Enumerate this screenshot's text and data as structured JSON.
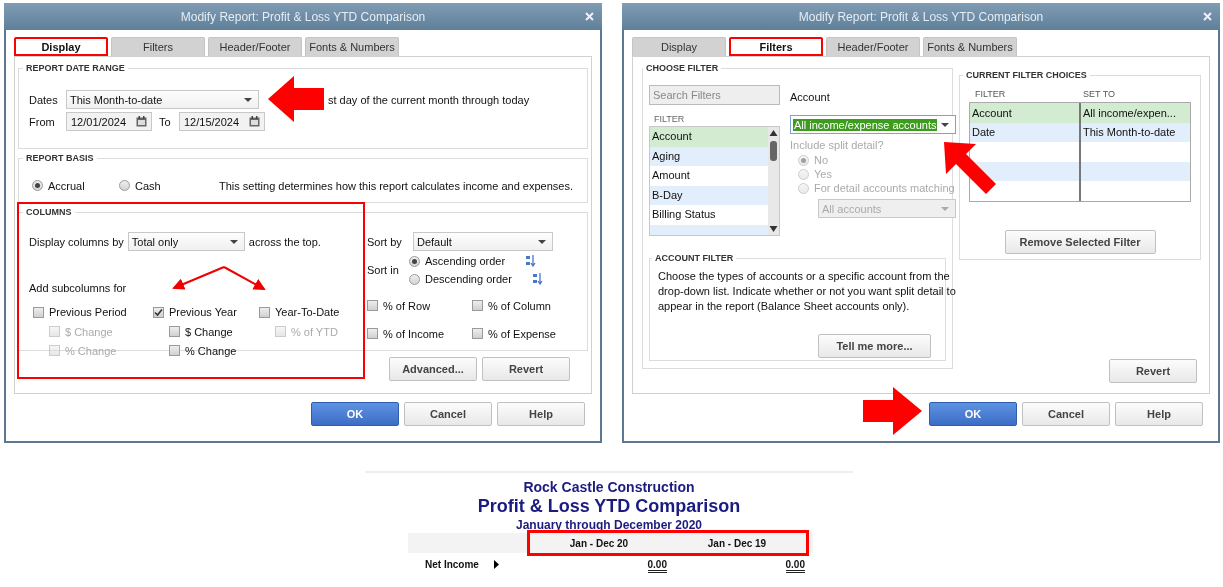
{
  "display_dialog": {
    "title": "Modify Report: Profit & Loss YTD Comparison",
    "tabs": [
      {
        "label": "Display",
        "selected": true,
        "highlighted": true
      },
      {
        "label": "Filters",
        "selected": false,
        "highlighted": false
      },
      {
        "label": "Header/Footer",
        "selected": false,
        "highlighted": false
      },
      {
        "label": "Fonts & Numbers",
        "selected": false,
        "highlighted": false
      }
    ],
    "report_date_range": {
      "heading": "REPORT DATE RANGE",
      "dates_label": "Dates",
      "dates_value": "This Month-to-date",
      "description": "st day of the current month through today",
      "from_label": "From",
      "from_value": "12/01/2024",
      "to_label": "To",
      "to_value": "12/15/2024"
    },
    "report_basis": {
      "heading": "REPORT BASIS",
      "options": [
        {
          "label": "Accrual",
          "selected": true
        },
        {
          "label": "Cash",
          "selected": false
        }
      ],
      "note": "This setting determines how this report calculates income and expenses."
    },
    "columns": {
      "heading": "COLUMNS",
      "highlighted": true,
      "display_by_label": "Display columns by",
      "display_by_value": "Total only",
      "display_by_suffix": "across the top.",
      "subcolumns_label": "Add subcolumns for",
      "subcolumn_groups": [
        {
          "label": "Previous Period",
          "checked": false,
          "options": [
            {
              "label": "$ Change",
              "checked": false,
              "disabled": true
            },
            {
              "label": "% Change",
              "checked": false,
              "disabled": true
            }
          ]
        },
        {
          "label": "Previous Year",
          "checked": true,
          "options": [
            {
              "label": "$ Change",
              "checked": false,
              "disabled": false
            },
            {
              "label": "% Change",
              "checked": false,
              "disabled": false
            }
          ]
        },
        {
          "label": "Year-To-Date",
          "checked": false,
          "options": [
            {
              "label": "% of YTD",
              "checked": false,
              "disabled": true
            }
          ]
        }
      ],
      "sort_by_label": "Sort by",
      "sort_by_value": "Default",
      "sort_in_label": "Sort in",
      "sort_orders": [
        {
          "label": "Ascending order",
          "selected": true
        },
        {
          "label": "Descending order",
          "selected": false
        }
      ],
      "percent_options": [
        {
          "label": "% of Row",
          "checked": false
        },
        {
          "label": "% of Column",
          "checked": false
        },
        {
          "label": "% of Income",
          "checked": false
        },
        {
          "label": "% of Expense",
          "checked": false
        }
      ]
    },
    "group_buttons": [
      "Advanced...",
      "Revert"
    ],
    "buttons": [
      {
        "label": "OK",
        "kind": "primary"
      },
      {
        "label": "Cancel",
        "kind": "normal"
      },
      {
        "label": "Help",
        "kind": "normal"
      }
    ]
  },
  "filters_dialog": {
    "title": "Modify Report: Profit & Loss YTD Comparison",
    "tabs": [
      {
        "label": "Display",
        "selected": false,
        "highlighted": false
      },
      {
        "label": "Filters",
        "selected": true,
        "highlighted": true
      },
      {
        "label": "Header/Footer",
        "selected": false,
        "highlighted": false
      },
      {
        "label": "Fonts & Numbers",
        "selected": false,
        "highlighted": false
      }
    ],
    "choose_filter": {
      "heading": "CHOOSE FILTER",
      "search_placeholder": "Search Filters",
      "list_heading": "FILTER",
      "filters": [
        {
          "label": "Account",
          "selected": true
        },
        {
          "label": "Aging",
          "selected": false
        },
        {
          "label": "Amount",
          "selected": false
        },
        {
          "label": "B-Day",
          "selected": false
        },
        {
          "label": "Billing Status",
          "selected": false
        }
      ],
      "field_label": "Account",
      "account_value": "All income/expense accounts",
      "account_text_selected": true,
      "split_question": "Include split detail?",
      "split_disabled": true,
      "split_options": [
        {
          "label": "No",
          "selected": true
        },
        {
          "label": "Yes",
          "selected": false
        },
        {
          "label": "For detail accounts matching",
          "selected": false
        }
      ],
      "matching_value": "All accounts",
      "account_filter": {
        "heading": "ACCOUNT FILTER",
        "text": "Choose the types of accounts or a specific account from the drop-down list. Indicate whether or not you want split detail to appear in the report (Balance Sheet accounts only).",
        "button": "Tell me more..."
      }
    },
    "current_filters": {
      "heading": "CURRENT FILTER CHOICES",
      "columns": [
        "FILTER",
        "SET TO"
      ],
      "rows": [
        {
          "filter": "Account",
          "set_to": "All income/expen...",
          "selected": true
        },
        {
          "filter": "Date",
          "set_to": "This Month-to-date",
          "selected": false
        }
      ],
      "button": "Remove Selected Filter"
    },
    "revert_button": "Revert",
    "buttons": [
      {
        "label": "OK",
        "kind": "primary"
      },
      {
        "label": "Cancel",
        "kind": "normal"
      },
      {
        "label": "Help",
        "kind": "normal"
      }
    ]
  },
  "report": {
    "company": "Rock Castle Construction",
    "title": "Profit & Loss YTD Comparison",
    "subtitle": "January through December 2020",
    "header_highlighted": true,
    "columns": [
      "Jan - Dec 20",
      "Jan - Dec 19"
    ],
    "rows": [
      {
        "label": "Net Income",
        "values": [
          "0.00",
          "0.00"
        ]
      }
    ]
  }
}
